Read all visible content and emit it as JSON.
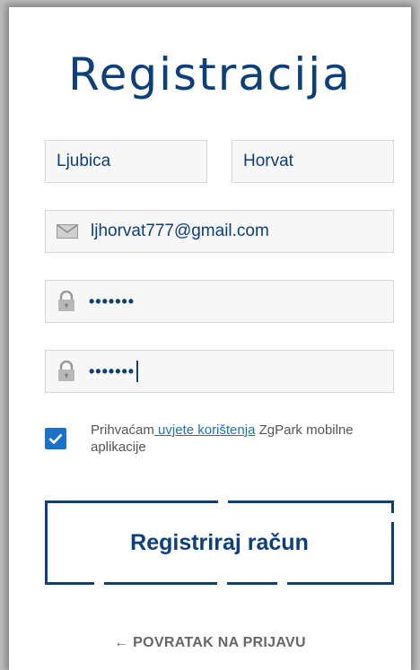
{
  "title": "Registracija",
  "first_name": {
    "value": "Ljubica"
  },
  "last_name": {
    "value": "Horvat"
  },
  "email": {
    "value": "ljhorvat777@gmail.com",
    "icon": "mail-icon"
  },
  "password": {
    "value": "•••••••",
    "icon": "lock-icon"
  },
  "password_confirm": {
    "value": "•••••••",
    "icon": "lock-icon"
  },
  "terms": {
    "checked": true,
    "prefix": "Prihvaćam",
    "link": " uvjete korištenja",
    "suffix": " ZgPark mobilne aplikacije"
  },
  "register_button": "Registriraj račun",
  "back_link": "← POVRATAK NA PRIJAVU",
  "colors": {
    "primary": "#0d3f78",
    "accent": "#1a73c8",
    "field_bg": "#f7f7f7"
  }
}
